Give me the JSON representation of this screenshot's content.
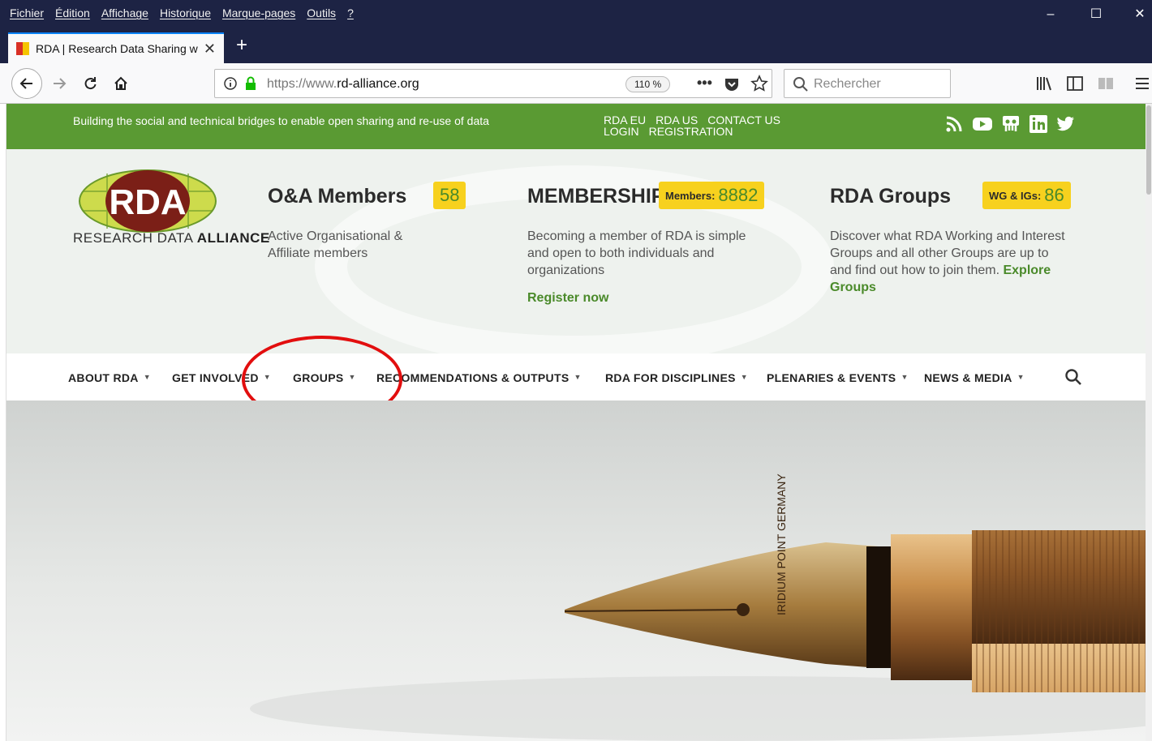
{
  "menubar": {
    "items": [
      "Fichier",
      "Édition",
      "Affichage",
      "Historique",
      "Marque-pages",
      "Outils",
      "?"
    ]
  },
  "tab": {
    "title": "RDA | Research Data Sharing w",
    "close": "✕",
    "new_tab": "+"
  },
  "toolbar": {
    "url_prefix": "https://www.",
    "url_domain": "rd-alliance.org",
    "zoom": "110 %",
    "search_placeholder": "Rechercher"
  },
  "topbar": {
    "tagline": "Building the social and technical bridges to enable open sharing and re-use of data",
    "links": [
      "RDA EU",
      "RDA US",
      "CONTACT US",
      "LOGIN",
      "REGISTRATION"
    ],
    "social": [
      "rss-icon",
      "youtube-icon",
      "slideshare-icon",
      "linkedin-icon",
      "twitter-icon"
    ]
  },
  "logo": {
    "text": "RDA",
    "subtitle_light": "RESEARCH DATA ",
    "subtitle_bold": "ALLIANCE"
  },
  "stats": {
    "oa": {
      "title": "O&A Members",
      "count": "58",
      "description": "Active Organisational & Affiliate members"
    },
    "membership": {
      "title": "MEMBERSHIP",
      "badge_label": "Members:",
      "count": "8882",
      "description": "Becoming a member of RDA is simple and open to both individuals and organizations",
      "link": "Register now"
    },
    "groups": {
      "title": "RDA Groups",
      "badge_label": "WG & IGs:",
      "count": "86",
      "description": "Discover what RDA Working and Interest Groups and all other Groups are up to and find out how to join them.",
      "link": "Explore Groups"
    }
  },
  "mainnav": {
    "items": [
      "ABOUT RDA",
      "GET INVOLVED",
      "GROUPS",
      "RECOMMENDATIONS & OUTPUTS",
      "RDA FOR DISCIPLINES",
      "PLENARIES & EVENTS",
      "NEWS & MEDIA"
    ]
  },
  "hero_image": {
    "pen_engraving": "IRIDIUM POINT GERMANY"
  },
  "colors": {
    "green": "#5a9a33",
    "yellow_badge": "#f7d11e",
    "annotation": "#e20e0e",
    "browser_chrome": "#1d2344"
  }
}
